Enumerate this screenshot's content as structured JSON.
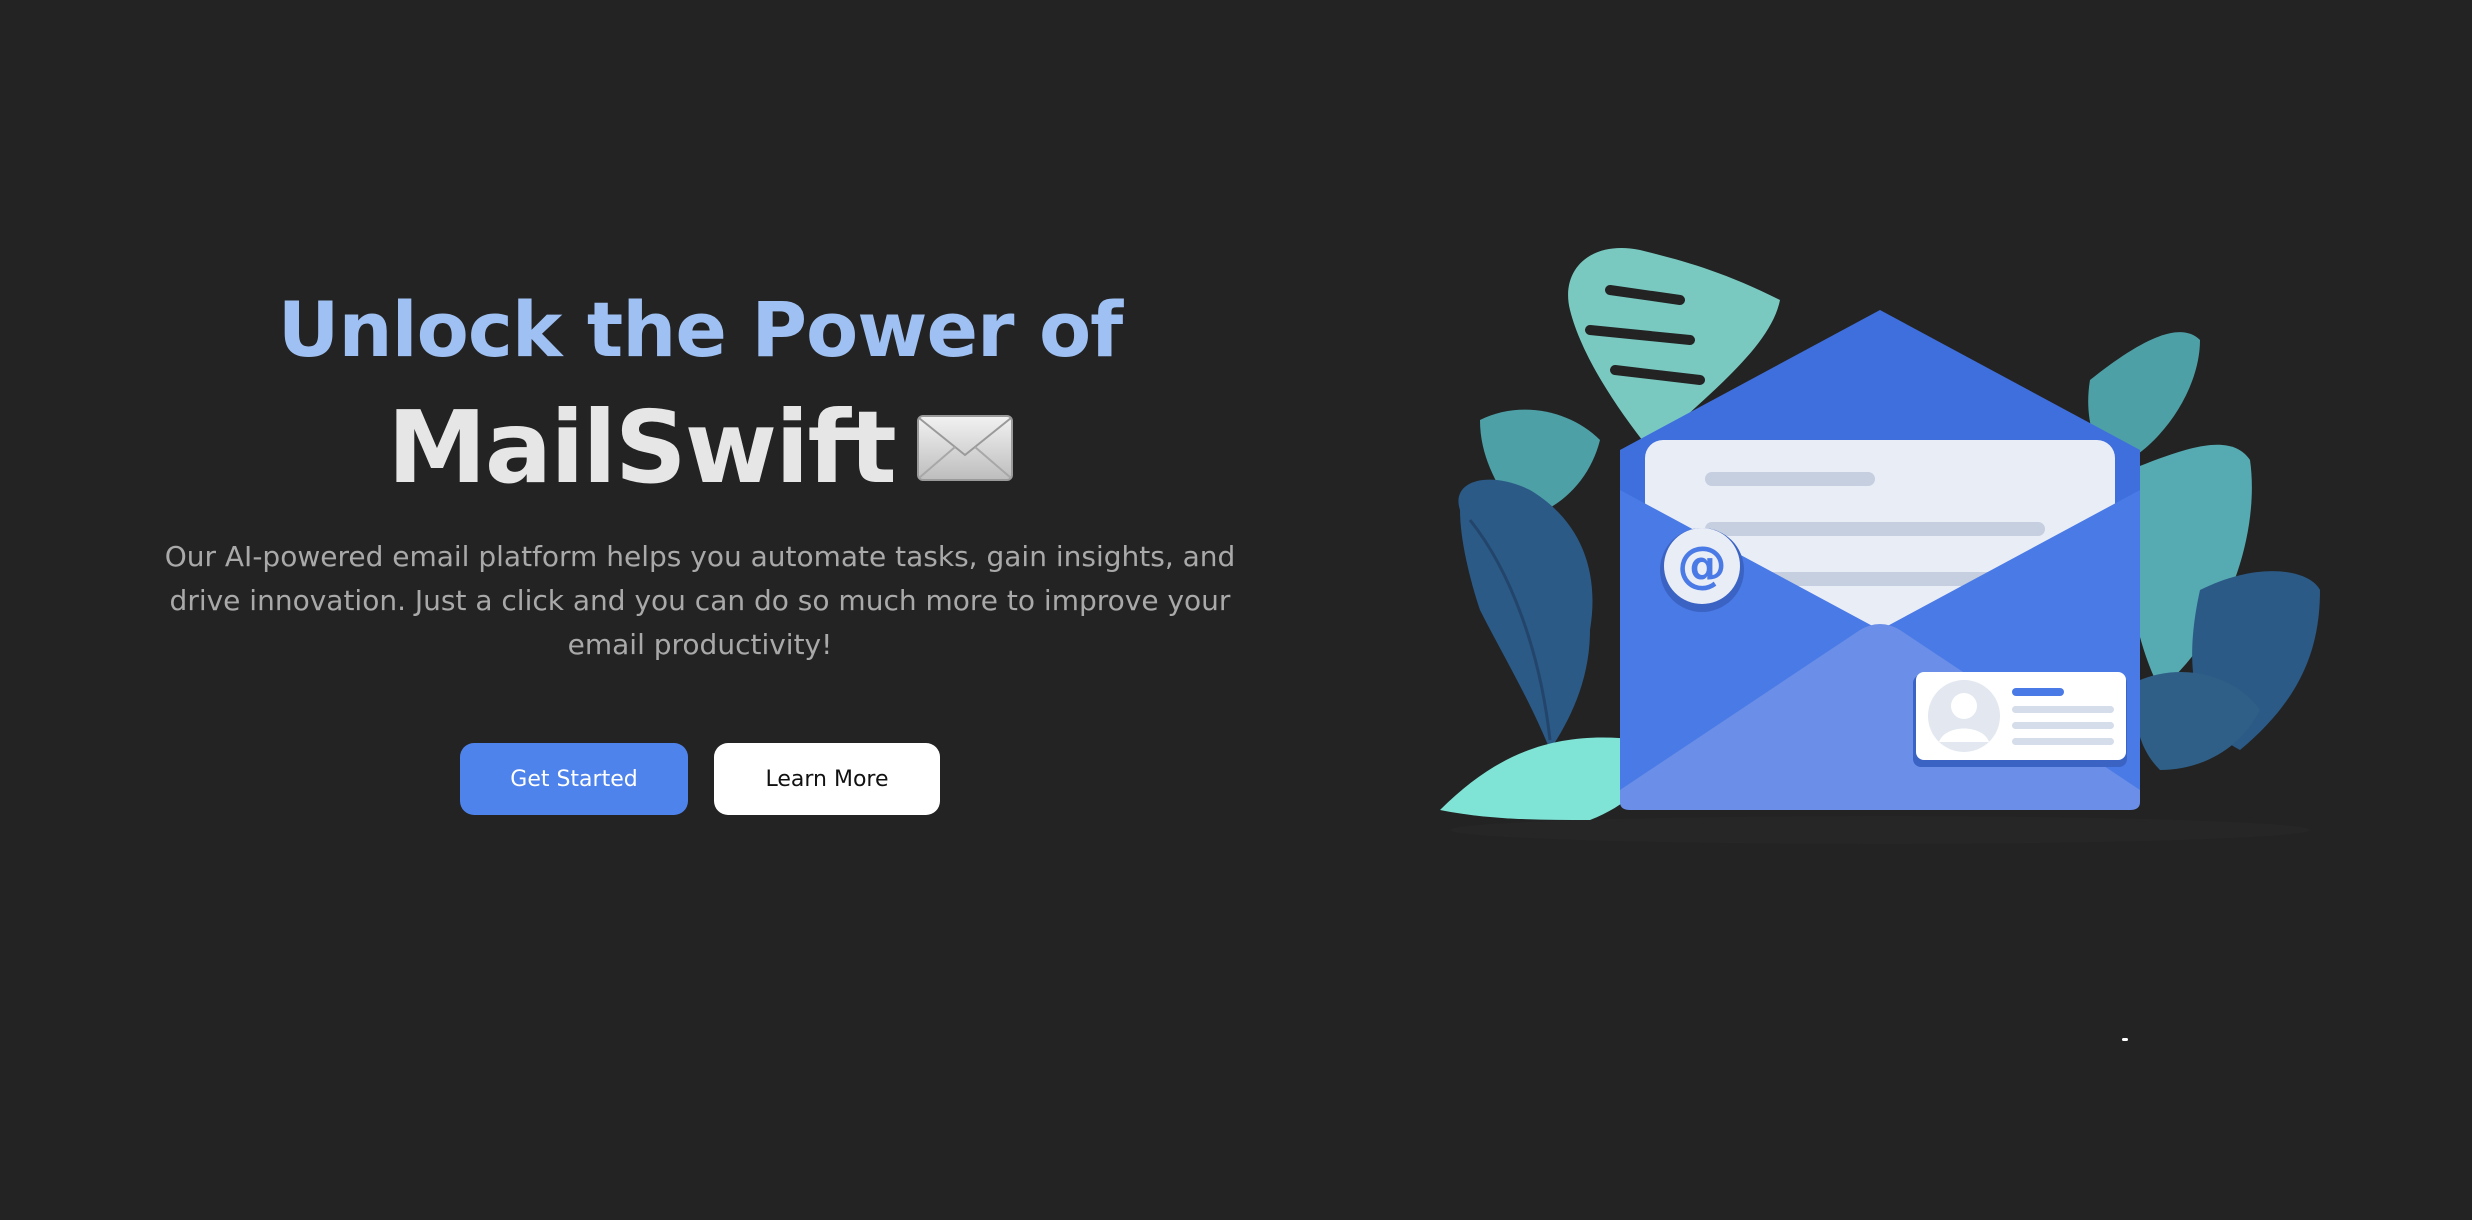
{
  "hero": {
    "headline_top": "Unlock the Power of",
    "brand_name": "MailSwift",
    "brand_emoji_icon": "envelope-emoji-icon",
    "description": "Our AI-powered email platform helps you automate tasks, gain insights, and drive innovation. Just a click and you can do so much more to improve your email productivity!",
    "primary_button": "Get Started",
    "secondary_button": "Learn More"
  },
  "illustration": {
    "icon": "email-envelope-illustration",
    "at_symbol": "@"
  },
  "colors": {
    "background": "#232323",
    "headline_accent": "#9fc0f3",
    "brand_text": "#e6e6e6",
    "primary_button": "#4f83ec",
    "envelope_blue": "#4a7ae6"
  }
}
